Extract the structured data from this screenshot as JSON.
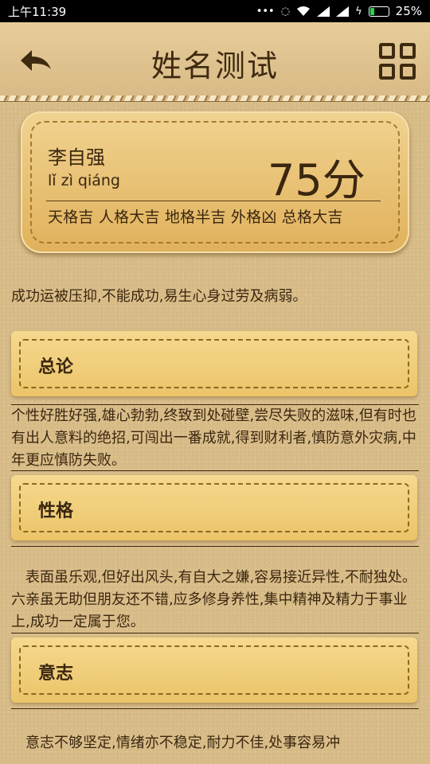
{
  "status_bar": {
    "time": "上午11:39",
    "battery": "25%",
    "battery_level": 0.25
  },
  "header": {
    "title": "姓名测试"
  },
  "result": {
    "name": "李自强",
    "pinyin": "lǐ zì qiáng",
    "score": "75分",
    "grades": "天格吉 人格大吉 地格半吉 外格凶 总格大吉"
  },
  "summary": "成功运被压抑,不能成功,易生心身过劳及病弱。",
  "sections": [
    {
      "title": "总论",
      "body": "个性好胜好强,雄心勃勃,终致到处碰壁,尝尽失败的滋味,但有时也有出人意料的绝招,可闯出一番成就,得到财利者,慎防意外灾病,中年更应慎防失败。"
    },
    {
      "title": "性格",
      "body": "　表面虽乐观,但好出风头,有自大之嫌,容易接近异性,不耐独处。六亲虽无助但朋友还不错,应多修身养性,集中精神及精力于事业上,成功一定属于您。"
    },
    {
      "title": "意志",
      "body": "　意志不够坚定,情绪亦不稳定,耐力不佳,处事容易冲"
    }
  ]
}
